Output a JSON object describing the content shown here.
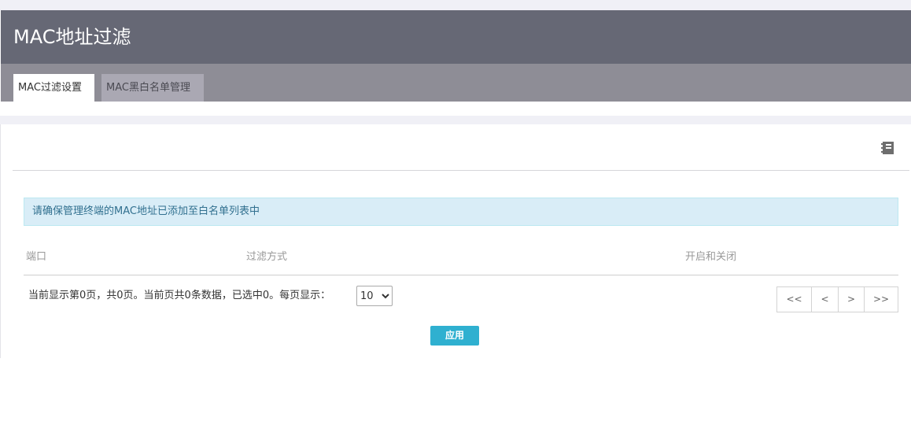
{
  "page": {
    "title": "MAC地址过滤"
  },
  "tabs": [
    {
      "label": "MAC过滤设置",
      "active": true
    },
    {
      "label": "MAC黑白名单管理",
      "active": false
    }
  ],
  "toolbar": {
    "help_icon": "notebook-icon"
  },
  "alert": {
    "text": "请确保管理终端的MAC地址已添加至白名单列表中"
  },
  "table": {
    "columns": [
      "端口",
      "过滤方式",
      "开启和关闭"
    ],
    "rows": []
  },
  "pager": {
    "summary": "当前显示第0页，共0页。当前页共0条数据，已选中0。每页显示：",
    "page_size": "10",
    "page_size_options": [
      "10"
    ],
    "buttons": {
      "first": "<<",
      "prev": "<",
      "next": ">",
      "last": ">>"
    }
  },
  "actions": {
    "apply_label": "应用"
  },
  "colors": {
    "header_bg": "#666875",
    "tabbar_bg": "#8e8d96",
    "accent": "#2fb0d0",
    "alert_bg": "#d9edf7"
  }
}
